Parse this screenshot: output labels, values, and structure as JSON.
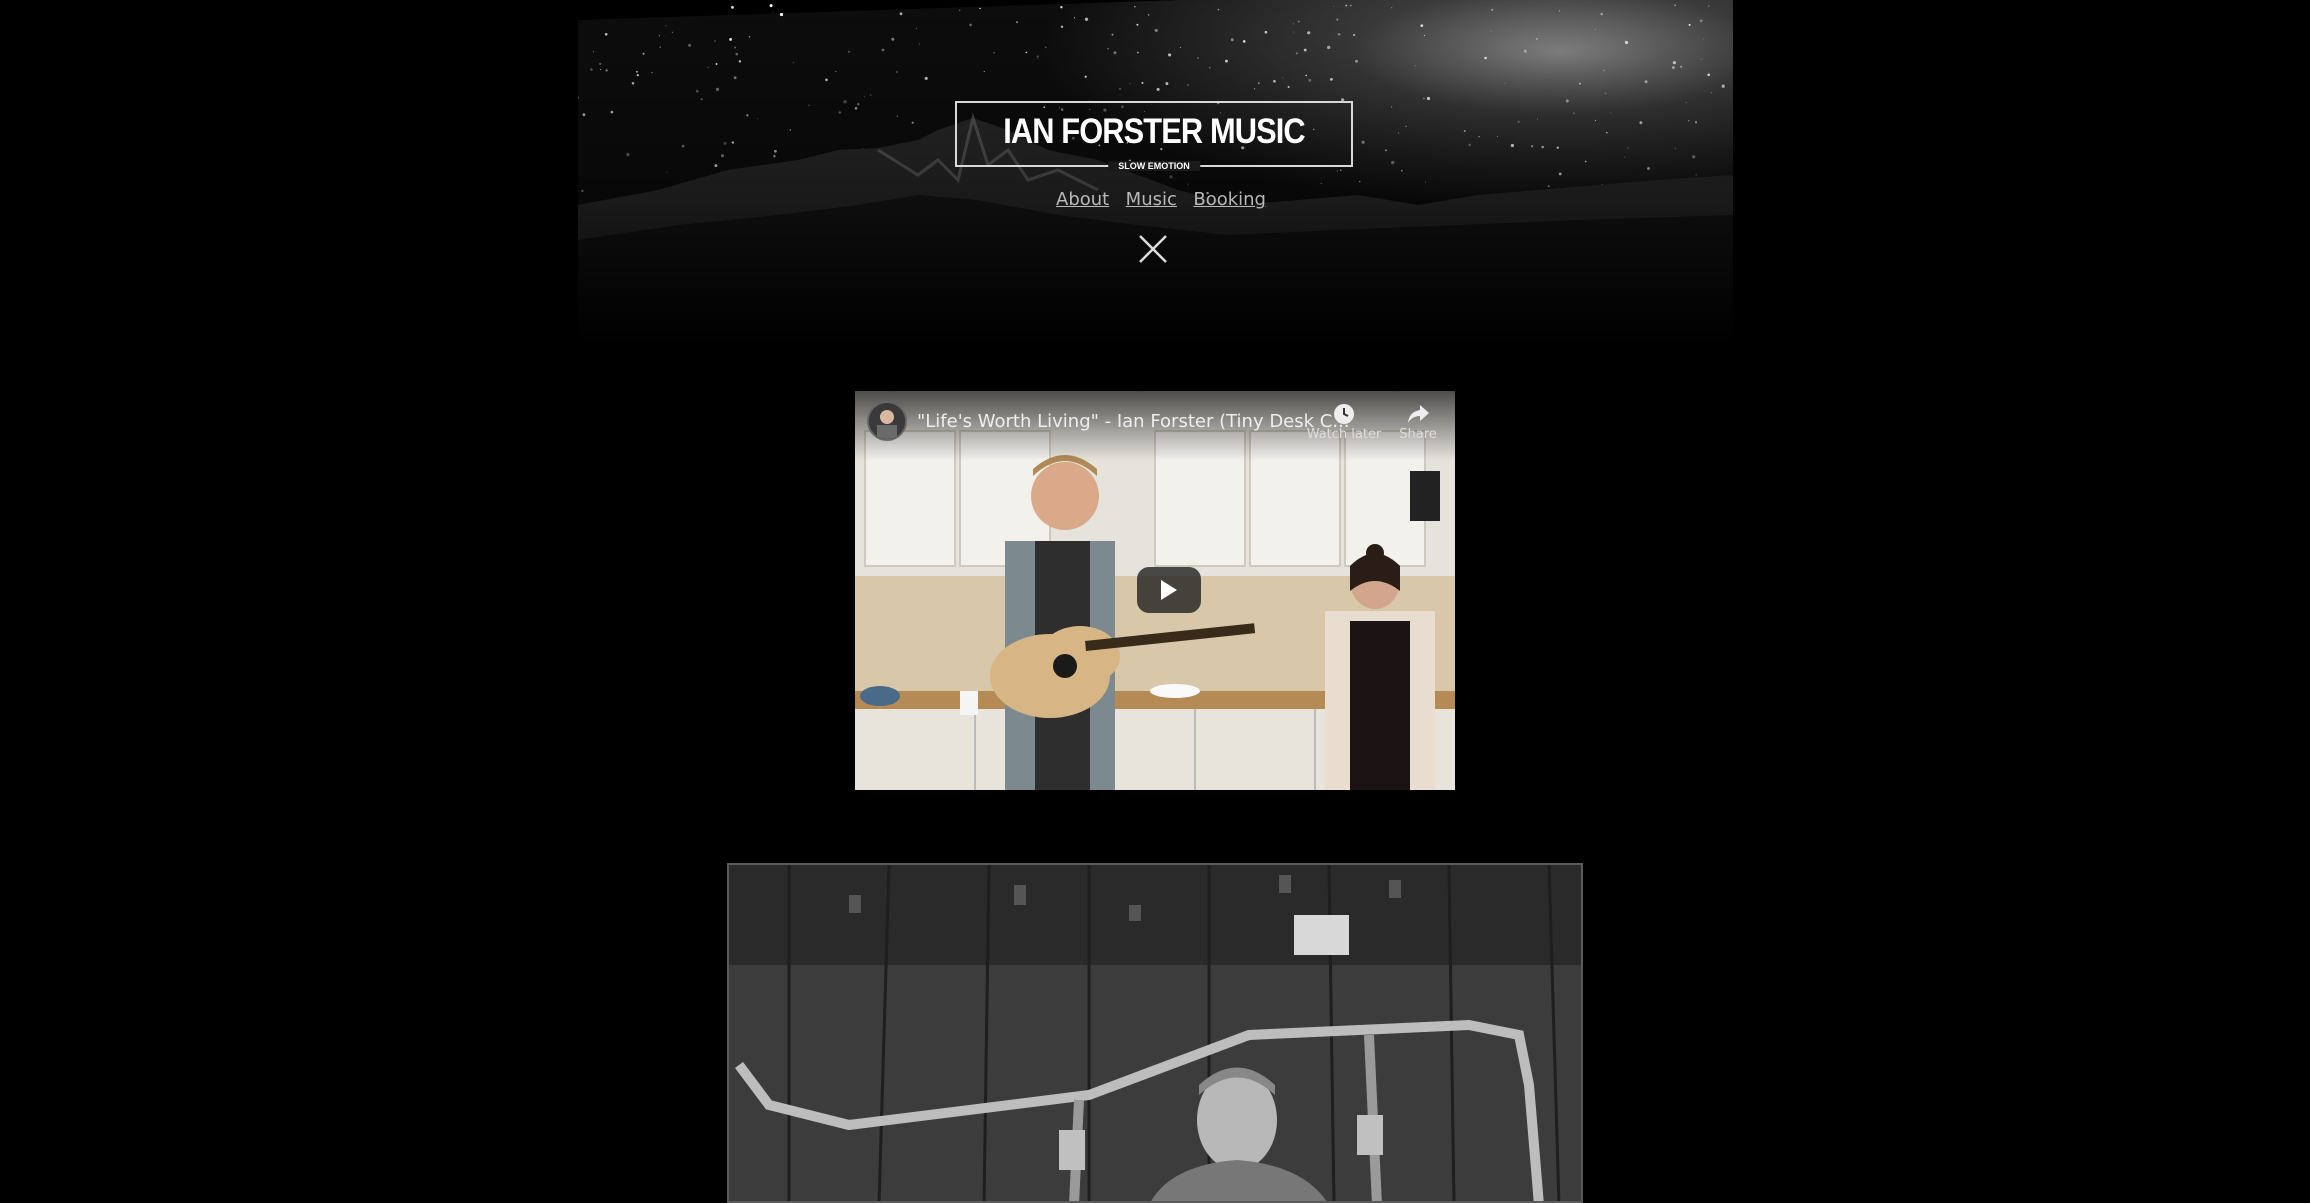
{
  "site": {
    "title": "IAN FORSTER MUSIC",
    "tagline": "SLOW EMOTION"
  },
  "nav": {
    "items": [
      {
        "label": "About"
      },
      {
        "label": "Music"
      },
      {
        "label": "Booking"
      }
    ]
  },
  "menu": {
    "close_icon": "close-x-icon"
  },
  "video": {
    "title": "\"Life's Worth Living\" - Ian Forster (Tiny Desk C...",
    "watch_later_label": "Watch later",
    "share_label": "Share",
    "watch_later_icon": "clock-icon",
    "share_icon": "share-arrow-icon",
    "play_icon": "play-icon"
  },
  "photo": {
    "alt": "Black and white photo of musician leaning on train car railing"
  }
}
